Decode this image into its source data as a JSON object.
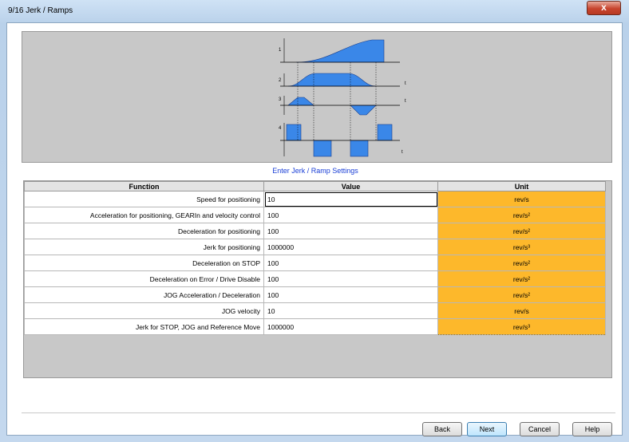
{
  "window": {
    "title": "9/16 Jerk / Ramps",
    "close_glyph": "x"
  },
  "diagram": {
    "row_labels": [
      "1",
      "2",
      "3",
      "4"
    ],
    "t_label": "t",
    "fill_color": "#3a87e8",
    "background_color": "#c8c8c8"
  },
  "caption": "Enter Jerk / Ramp Settings",
  "table": {
    "headers": {
      "function": "Function",
      "value": "Value",
      "unit": "Unit"
    },
    "rows": [
      {
        "function": "Speed for positioning",
        "value": "10",
        "unit": "rev/s"
      },
      {
        "function": "Acceleration for positioning, GEARIn and velocity control",
        "value": "100",
        "unit": "rev/s²"
      },
      {
        "function": "Deceleration for positioning",
        "value": "100",
        "unit": "rev/s²"
      },
      {
        "function": "Jerk for positioning",
        "value": "1000000",
        "unit": "rev/s³"
      },
      {
        "function": "Deceleration on STOP",
        "value": "100",
        "unit": "rev/s²"
      },
      {
        "function": "Deceleration on Error / Drive Disable",
        "value": "100",
        "unit": "rev/s²"
      },
      {
        "function": "JOG Acceleration / Deceleration",
        "value": "100",
        "unit": "rev/s²"
      },
      {
        "function": "JOG velocity",
        "value": "10",
        "unit": "rev/s"
      },
      {
        "function": "Jerk for STOP, JOG and Reference Move",
        "value": "1000000",
        "unit": "rev/s³"
      }
    ],
    "unit_color": "#fdb82b"
  },
  "buttons": {
    "back": "Back",
    "next": "Next",
    "cancel": "Cancel",
    "help": "Help"
  }
}
